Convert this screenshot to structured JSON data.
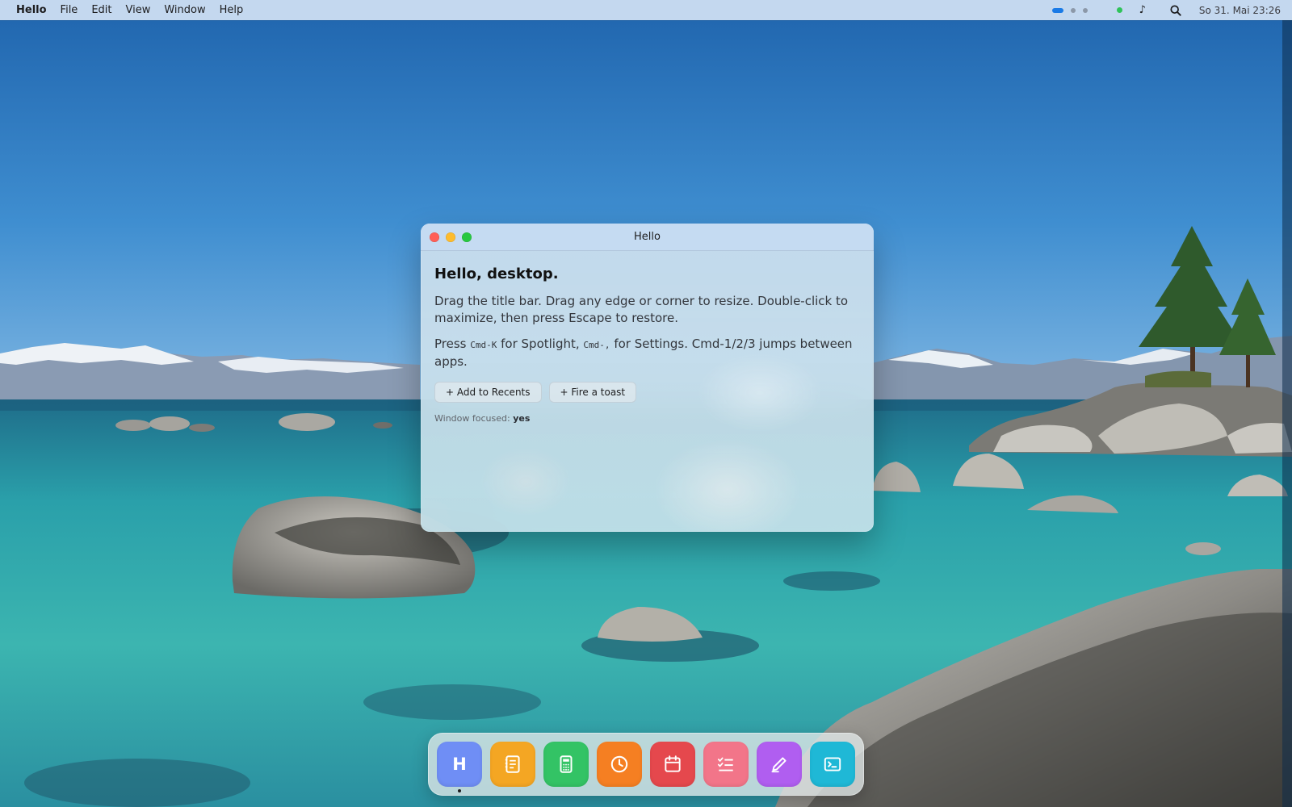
{
  "menubar": {
    "app_name": "Hello",
    "menus": [
      "File",
      "Edit",
      "View",
      "Window",
      "Help"
    ],
    "status_icons": [
      "space-indicator",
      "status-dot",
      "music-icon",
      "search-icon"
    ],
    "clock": "So 31. Mai 23:26"
  },
  "window": {
    "title": "Hello",
    "heading": "Hello, desktop.",
    "paragraph1": "Drag the title bar. Drag any edge or corner to resize. Double-click to maximize, then press Escape to restore.",
    "p2_press": "Press ",
    "p2_shortcut1": "Cmd-K",
    "p2_mid": " for Spotlight, ",
    "p2_shortcut2": "Cmd-,",
    "p2_end": " for Settings. Cmd-1/2/3 jumps between apps.",
    "button_add": "+ Add to Recents",
    "button_toast": "+ Fire a toast",
    "focus_label": "Window focused: ",
    "focus_value": "yes"
  },
  "dock": {
    "items": [
      {
        "name": "Hello",
        "icon": "hello-letter-icon",
        "letter": "H",
        "color": "#6f8ef5",
        "running": true
      },
      {
        "name": "Notes",
        "icon": "notes-icon",
        "color": "#f4a623",
        "running": false
      },
      {
        "name": "Calculator",
        "icon": "calculator-icon",
        "color": "#33c365",
        "running": false
      },
      {
        "name": "Clock",
        "icon": "clock-icon",
        "color": "#f57f22",
        "running": false
      },
      {
        "name": "Calendar",
        "icon": "calendar-icon",
        "color": "#e5484d",
        "running": false
      },
      {
        "name": "Reminders",
        "icon": "checklist-icon",
        "color": "#f27589",
        "running": false
      },
      {
        "name": "Draw",
        "icon": "pen-icon",
        "color": "#b05ef0",
        "running": false
      },
      {
        "name": "Terminal",
        "icon": "terminal-icon",
        "color": "#1fb8d6",
        "running": false
      }
    ]
  },
  "colors": {
    "accent": "#1a7ae6",
    "close": "#ff5f57",
    "minimize": "#febc2e",
    "maximize": "#28c840"
  }
}
